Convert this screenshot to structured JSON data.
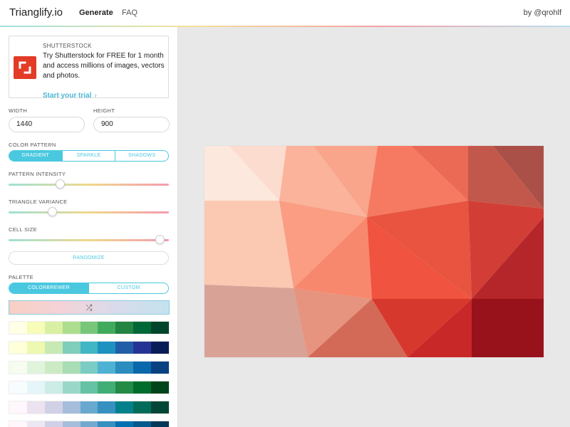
{
  "header": {
    "logo": "Trianglify.io",
    "nav": [
      {
        "label": "Generate",
        "active": true
      },
      {
        "label": "FAQ",
        "active": false
      }
    ],
    "byline": "by @qrohlf"
  },
  "ad": {
    "brand": "SHUTTERSTOCK",
    "text": "Try Shutterstock for FREE for 1 month and access millions of images, vectors and photos.",
    "cta": "Start your trial",
    "cta_chevron": "›",
    "logo_color": "#e33b26"
  },
  "dimensions": {
    "width_label": "WIDTH",
    "width_value": "1440",
    "height_label": "HEIGHT",
    "height_value": "900"
  },
  "color_pattern": {
    "label": "COLOR PATTERN",
    "options": [
      "GRADIENT",
      "SPARKLE",
      "SHADOWS"
    ],
    "selected": "GRADIENT"
  },
  "sliders": {
    "intensity": {
      "label": "PATTERN INTENSITY",
      "value": 0.31
    },
    "variance": {
      "label": "TRIANGLE VARIANCE",
      "value": 0.26
    },
    "cell_size": {
      "label": "CELL SIZE",
      "value": 0.97
    }
  },
  "randomize_label": "RANDOMIZE",
  "palette": {
    "label": "PALETTE",
    "options": [
      "COLORBREWER",
      "CUSTOM"
    ],
    "selected": "COLORBREWER",
    "shuffle_icon": "⤮",
    "rows": [
      [
        "#ffffe5",
        "#f7fcb9",
        "#d9f0a3",
        "#addd8e",
        "#78c679",
        "#41ab5d",
        "#238443",
        "#006837",
        "#004529"
      ],
      [
        "#ffffd9",
        "#edf8b1",
        "#c7e9b4",
        "#7fcdbb",
        "#41b6c4",
        "#1d91c0",
        "#225ea8",
        "#253494",
        "#081d58"
      ],
      [
        "#f7fcf0",
        "#e0f3db",
        "#ccebc5",
        "#a8ddb5",
        "#7bccc4",
        "#4eb3d3",
        "#2b8cbe",
        "#0868ac",
        "#084081"
      ],
      [
        "#f7fcfd",
        "#e5f5f9",
        "#ccece6",
        "#99d8c9",
        "#66c2a4",
        "#41ae76",
        "#238b45",
        "#006d2c",
        "#00441b"
      ],
      [
        "#fff7fb",
        "#ece2f0",
        "#d0d1e6",
        "#a6bddb",
        "#67a9cf",
        "#3690c0",
        "#02818a",
        "#016c59",
        "#014636"
      ],
      [
        "#fff7fb",
        "#ece7f2",
        "#d0d1e6",
        "#a6bddb",
        "#74a9cf",
        "#3690c0",
        "#0570b0",
        "#045a8d",
        "#023858"
      ]
    ]
  },
  "colors": {
    "accent": "#4ac8e0"
  }
}
